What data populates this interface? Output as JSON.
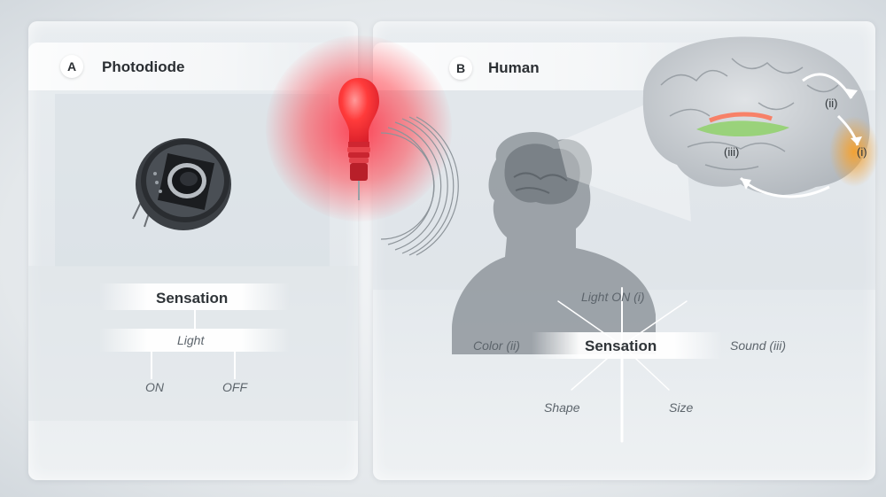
{
  "panel_a": {
    "badge": "A",
    "title": "Photodiode",
    "sensation": "Sensation",
    "light": "Light",
    "on": "ON",
    "off": "OFF"
  },
  "panel_b": {
    "badge": "B",
    "title": "Human",
    "sensation": "Sensation",
    "light_on": "Light ON (i)",
    "color": "Color (ii)",
    "sound": "Sound (iii)",
    "shape": "Shape",
    "size": "Size",
    "brain_labels": [
      "(i)",
      "(ii)",
      "(iii)"
    ]
  },
  "colors": {
    "bulb_red": "#ff3b3b",
    "glow_red": "#ff4b5a",
    "silhouette": "#8f969c",
    "brain": "#c9cdd1",
    "region_green": "#8fd16a",
    "region_orange": "#f5a23a"
  },
  "icons": [
    "photodiode-icon",
    "light-bulb-icon",
    "sound-waves-icon",
    "head-silhouette-icon",
    "brain-icon"
  ]
}
